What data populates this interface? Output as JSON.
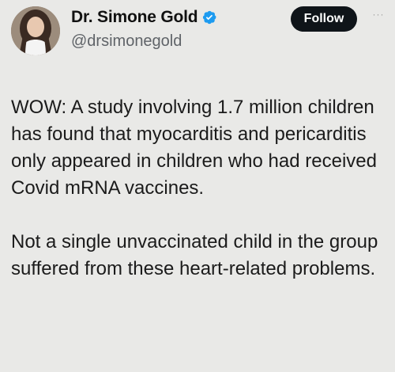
{
  "tweet": {
    "author": {
      "display_name": "Dr. Simone Gold",
      "handle": "@drsimonegold",
      "verified_icon": "verified-badge-icon",
      "verified_color": "#1d9bf0"
    },
    "follow_label": "Follow",
    "more_label": "···",
    "paragraphs": [
      "WOW: A study involving 1.7 million children has found that myocarditis and pericarditis only appeared in children who had received Covid mRNA vaccines.",
      "Not a single unvaccinated child in the group suffered from these heart-related problems."
    ]
  }
}
